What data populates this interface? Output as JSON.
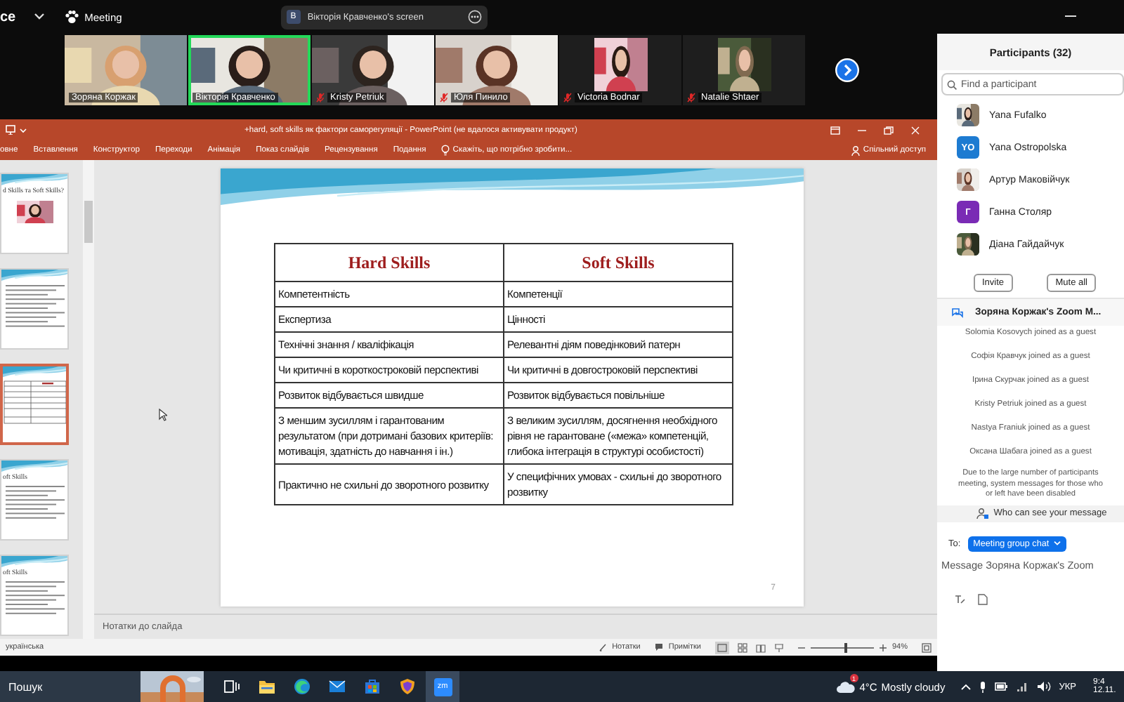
{
  "top_bar": {
    "app_label": "ce",
    "meeting_label": "Meeting",
    "share_pill": {
      "initial": "В",
      "title": "Вікторія Кравченко's screen"
    }
  },
  "video_strip": {
    "tiles": [
      {
        "name": "Зоряна Коржак",
        "kind": "video",
        "muted": false,
        "speaking": false
      },
      {
        "name": "Вікторія Кравченко",
        "kind": "video",
        "muted": false,
        "speaking": true
      },
      {
        "name": "Kristy Petriuk",
        "kind": "video",
        "muted": true,
        "speaking": false
      },
      {
        "name": "Юля Пинило",
        "kind": "video",
        "muted": true,
        "speaking": false
      },
      {
        "name": "Victoria Bodnar",
        "muted": true,
        "speaking": false
      },
      {
        "name": "Natalie Shtaer",
        "muted": true,
        "speaking": false
      }
    ]
  },
  "powerpoint": {
    "title": "+hard, soft skills як фактори саморегуляції  -  PowerPoint (не вдалося активувати продукт)",
    "ribbon_tabs": [
      "овне",
      "Вставлення",
      "Конструктор",
      "Переходи",
      "Анімація",
      "Показ слайдів",
      "Рецензування",
      "Подання"
    ],
    "tell_me": "Скажіть, що потрібно зробити...",
    "share": "Спільний доступ",
    "thumbnails": [
      {
        "kind": "title-image",
        "title": "d Skills та Soft Skills?",
        "selected": false
      },
      {
        "kind": "text",
        "selected": false
      },
      {
        "kind": "table",
        "selected": true
      },
      {
        "kind": "text",
        "title": "oft Skills",
        "selected": false
      },
      {
        "kind": "text",
        "title": "oft Skills",
        "selected": false
      }
    ],
    "slide": {
      "table": {
        "columns": [
          "Hard Skills",
          "Soft Skills"
        ],
        "rows": [
          [
            "Компетентність",
            "Компетенції"
          ],
          [
            "Експертиза",
            "Цінності"
          ],
          [
            "Технічні знання / кваліфікація",
            "Релевантні діям поведінковий патерн"
          ],
          [
            "Чи критичні в короткостроковій перспективі",
            "Чи критичні в довгостроковій перспективі"
          ],
          [
            "Розвиток відбувається швидше",
            "Розвиток відбувається повільніше"
          ],
          [
            "З меншим зусиллям і гарантованим результатом (при дотримані базових критеріїв: мотивація, здатність до навчання і ін.)",
            "З великим зусиллям, досягнення необхідного рівня не гарантоване («межа» компетенцій, глибока інтеграція в структурі особистості)"
          ],
          [
            "Практично не схильні до зворотного розвитку",
            "У специфічних умовах - схильні до зворотного розвитку"
          ]
        ]
      },
      "page_number": "7"
    },
    "notes_placeholder": "Нотатки до слайда",
    "status_bar": {
      "language": "українська",
      "notes": "Нотатки",
      "comments": "Примітки",
      "zoom": {
        "level": 0.55,
        "reading": "94%"
      }
    }
  },
  "participants": {
    "title": "Participants (32)",
    "search": {
      "placeholder": "Find a participant"
    },
    "items": [
      {
        "name": "Yana Fufalko"
      },
      {
        "name": "Yana Ostropolska",
        "avatar": {
          "kind": "initials",
          "text": "YO",
          "color": "#1d7bd1"
        }
      },
      {
        "name": "Артур Маковійчук"
      },
      {
        "name": "Ганна Столяр",
        "avatar": {
          "kind": "initials",
          "text": "Г",
          "color": "#7a2bb5"
        }
      },
      {
        "name": "Діана Гайдайчук"
      }
    ],
    "buttons": [
      "Invite",
      "Mute all"
    ]
  },
  "chat": {
    "title": "Зоряна Коржак's Zoom M...",
    "messages": [
      "Solomia Kosovych joined as a guest",
      "Софія Кравчук joined as a guest",
      "Ірина Скурчак joined as a guest",
      "Kristy Petriuk joined as a guest",
      "Nastya Franiuk joined as a guest",
      "Оксана Шабага joined as a guest"
    ],
    "notice": [
      "Due to the large number of participants",
      "meeting, system messages for those who",
      "or left have been disabled"
    ],
    "privacy_link": "Who can see your message",
    "to_label": "To:",
    "recipient": "Meeting group chat",
    "input": {
      "placeholder": "Message Зоряна Коржак's Zoom"
    }
  },
  "taskbar": {
    "search": {
      "placeholder": "Пошук"
    },
    "apps": [
      {
        "kind": "task-view",
        "active": false
      },
      {
        "kind": "folder",
        "active": false
      },
      {
        "kind": "browser",
        "active": false
      },
      {
        "kind": "mail",
        "active": false
      },
      {
        "kind": "store",
        "active": false
      },
      {
        "kind": "shield",
        "active": false
      },
      {
        "kind": "zoom",
        "label": "zm",
        "active": true
      }
    ],
    "weather": {
      "badge": "1",
      "temperature": "4°C",
      "condition": "Mostly cloudy"
    },
    "language": "УКР",
    "time": "9:4",
    "date": "12.11."
  }
}
